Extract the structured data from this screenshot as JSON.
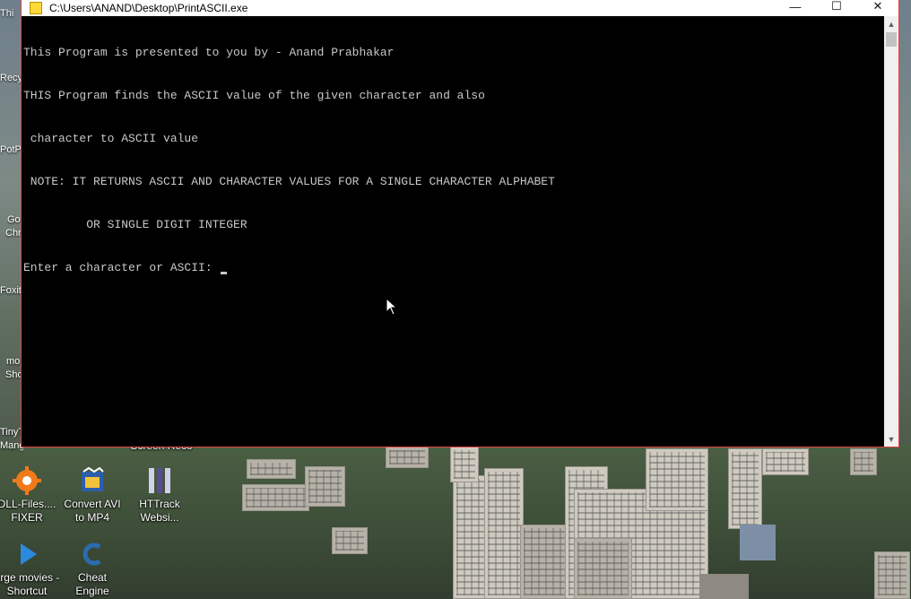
{
  "window": {
    "title": "C:\\Users\\ANAND\\Desktop\\PrintASCII.exe",
    "controls": {
      "minimize": "—",
      "maximize": "☐",
      "close": "✕"
    }
  },
  "console": {
    "lines": [
      "This Program is presented to you by - Anand Prabhakar",
      "THIS Program finds the ASCII value of the given character and also",
      " character to ASCII value",
      " NOTE: IT RETURNS ASCII AND CHARACTER VALUES FOR A SINGLE CHARACTER ALPHABET",
      "         OR SINGLE DIGIT INTEGER"
    ],
    "prompt": "Enter a character or ASCII: "
  },
  "desktop": {
    "icons": [
      {
        "label": "DLL-Files.... FIXER",
        "icon": "gear-icon"
      },
      {
        "label": "Convert AVI to MP4",
        "icon": "film-icon"
      },
      {
        "label": "HTTrack Websi...",
        "icon": "httrack-icon"
      },
      {
        "label": "arge movies - Shortcut",
        "icon": "play-icon"
      },
      {
        "label": "Cheat Engine",
        "icon": "cheat-engine-icon"
      }
    ],
    "edge_labels": [
      "Thi",
      "Recy",
      "PotPl",
      "Go",
      "Chr",
      "Foxit",
      "mo",
      "Sho",
      "TinyT",
      "Mang"
    ],
    "behind_window_text": "Screen Reco"
  },
  "colors": {
    "window_border": "#e04545",
    "console_bg": "#000000",
    "console_text": "#c8c8c8"
  }
}
